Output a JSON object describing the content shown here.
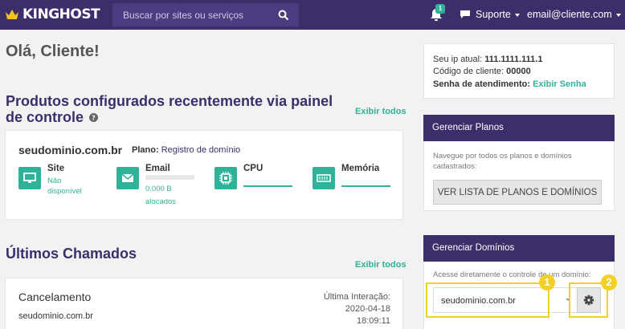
{
  "header": {
    "logo_text": "KINGHOST",
    "search_placeholder": "Buscar por sites ou serviços",
    "notification_count": "1",
    "support_label": "Suporte",
    "account_email": "email@cliente.com"
  },
  "main": {
    "greeting": "Olá, Cliente!",
    "products_title": "Produtos configurados recentemente via painel de controle",
    "view_all_label": "Exibir todos",
    "product": {
      "domain": "seudominio.com.br",
      "plan_label": "Plano:",
      "plan_value": "Registro de domínio",
      "services": {
        "site": {
          "label": "Site",
          "status_line1": "Não",
          "status_line2": "disponível"
        },
        "email": {
          "label": "Email",
          "usage_line1": "0.000 B",
          "usage_line2": "alocados",
          "usage_fraction": 0
        },
        "cpu": {
          "label": "CPU"
        },
        "memory": {
          "label": "Memória"
        }
      }
    },
    "tickets_title": "Últimos Chamados",
    "ticket": {
      "subject": "Cancelamento",
      "domain": "seudominio.com.br",
      "last_interaction_label": "Última Interação:",
      "date": "2020-04-18",
      "time": "18:09:11"
    }
  },
  "sidebar": {
    "ip_label": "Seu ip atual:",
    "ip_value": "111.1111.111.1",
    "client_code_label": "Código de cliente:",
    "client_code_value": "00000",
    "password_label": "Senha de atendimento:",
    "password_link": "Exibir Senha",
    "plans_panel": {
      "title": "Gerenciar Planos",
      "description_line1": "Navegue por todos os planos e domínios",
      "description_line2": "cadastrados:",
      "button_label": "VER LISTA DE PLANOS E DOMÍNIOS"
    },
    "domains_panel": {
      "title": "Gerenciar Domínios",
      "description": "Acesse diretamente o controle de um domínio:",
      "selected_domain": "seudominio.com.br"
    }
  },
  "annotations": [
    "1",
    "2"
  ],
  "colors": {
    "brand": "#3c2e6b",
    "accent": "#2eb398",
    "highlight": "#f3d026"
  },
  "icons": [
    "crown-icon",
    "search-icon",
    "bell-icon",
    "chat-icon",
    "help-icon",
    "monitor-icon",
    "envelope-icon",
    "cpu-icon",
    "memory-icon",
    "gear-icon"
  ]
}
